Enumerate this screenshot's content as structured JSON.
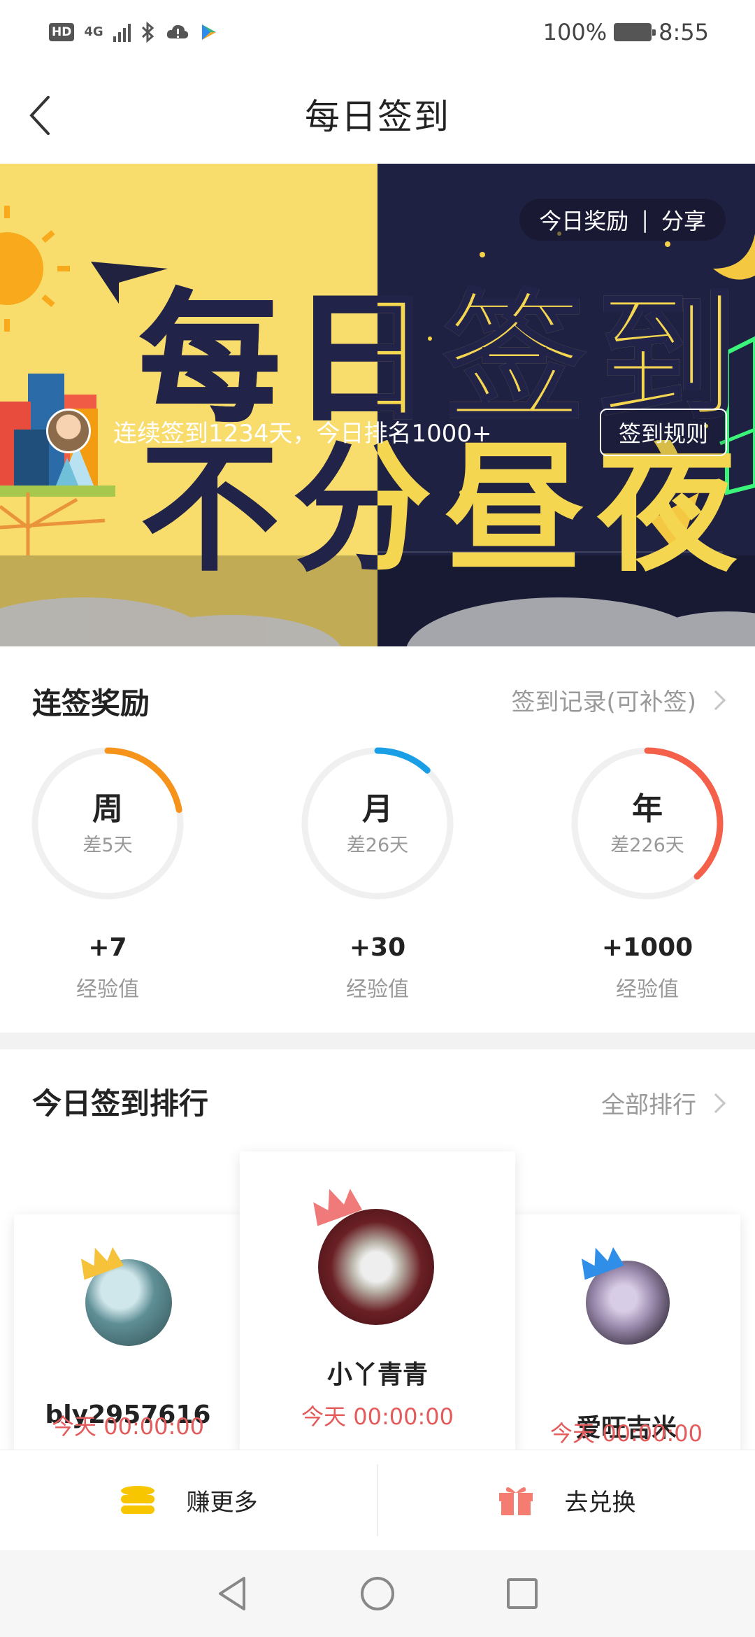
{
  "status_bar": {
    "hd": "HD",
    "network": "4G",
    "battery_percent": "100%",
    "time": "8:55"
  },
  "header": {
    "title": "每日签到"
  },
  "banner": {
    "headline_line1": "每日签到",
    "headline_line2": "不分昼夜",
    "pill_today": "今日奖励",
    "pill_sep": "|",
    "pill_share": "分享",
    "streak_text": "连续签到1234天，今日排名1000+",
    "rule_button": "签到规则"
  },
  "rewards": {
    "title": "连签奖励",
    "record_link": "签到记录(可补签)",
    "items": [
      {
        "label": "周",
        "diff": "差5天",
        "value": "+7",
        "unit": "经验值",
        "progress": 0.22,
        "color": "#f5931b"
      },
      {
        "label": "月",
        "diff": "差26天",
        "value": "+30",
        "unit": "经验值",
        "progress": 0.12,
        "color": "#1a9ee6"
      },
      {
        "label": "年",
        "diff": "差226天",
        "value": "+1000",
        "unit": "经验值",
        "progress": 0.38,
        "color": "#f4604a"
      }
    ]
  },
  "ranking": {
    "title": "今日签到排行",
    "all_link": "全部排行",
    "users": [
      {
        "name": "bly2957616",
        "time": "今天 00:00:00"
      },
      {
        "name": "小丫青青",
        "time": "今天 00:00:00"
      },
      {
        "name": "爱旺吉米",
        "time": "今天 00:00:00"
      }
    ]
  },
  "actions": {
    "earn_more": "赚更多",
    "exchange": "去兑换"
  },
  "colors": {
    "accent_red": "#e45b5b",
    "banner_yellow": "#f8dc6c",
    "banner_navy": "#1d1f3f"
  }
}
